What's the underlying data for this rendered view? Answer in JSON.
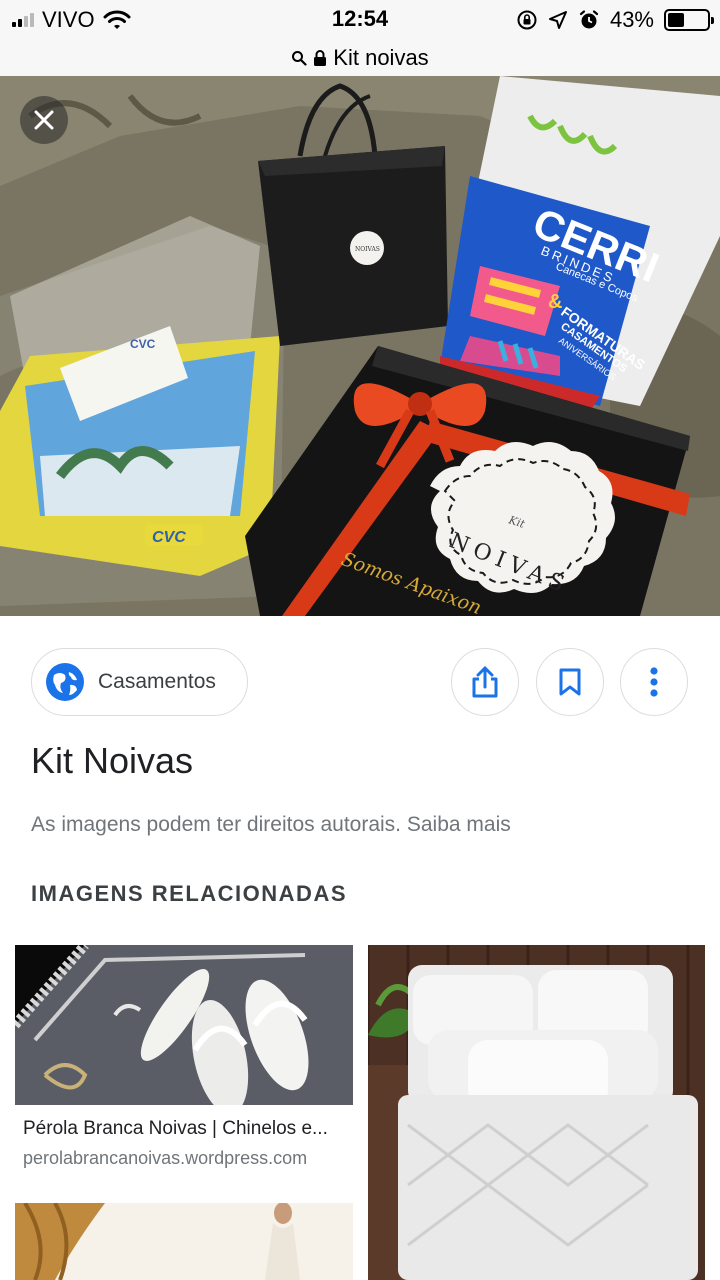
{
  "status_bar": {
    "carrier": "VIVO",
    "time": "12:54",
    "battery": "43%",
    "battery_level": 0.43
  },
  "url_bar": {
    "title": "Kit noivas",
    "icons": [
      "search-icon",
      "lock-icon"
    ]
  },
  "hero": {
    "close_icon": "close-icon",
    "visible_text": {
      "bag_logo": "NOIVAS",
      "cvc_card": "CVC",
      "cvc_book": "CVC",
      "brochure_brand": "CERRI",
      "brochure_sub": "BRINDES",
      "brochure_tag": "Canecas e Copos",
      "brochure_headline": "FORMATURAS",
      "brochure_amp": "&",
      "brochure_line2": "CASAMENTOS",
      "brochure_line3": "ANIVERSÁRIOS",
      "badge_kit": "Kit",
      "badge_noivas": "NOIVAS",
      "box_slogan": "Somos Apaixon"
    }
  },
  "actions": {
    "source_chip": {
      "label": "Casamentos",
      "icon": "globe-icon"
    },
    "share_icon": "share-icon",
    "save_icon": "bookmark-icon",
    "more_icon": "more-vert-icon"
  },
  "result": {
    "title": "Kit Noivas",
    "copyright_note": "As imagens podem ter direitos autorais. Saiba mais"
  },
  "related": {
    "heading": "IMAGENS RELACIONADAS",
    "items": [
      {
        "title": "Pérola Branca Noivas | Chinelos e...",
        "domain": "perolabrancanoivas.wordpress.com"
      },
      {
        "title": "",
        "domain": ""
      },
      {
        "title": "",
        "domain": ""
      }
    ]
  },
  "colors": {
    "accent_blue": "#1a73e8",
    "ribbon_red": "#d93a1a",
    "border_gray": "#dadce0"
  }
}
